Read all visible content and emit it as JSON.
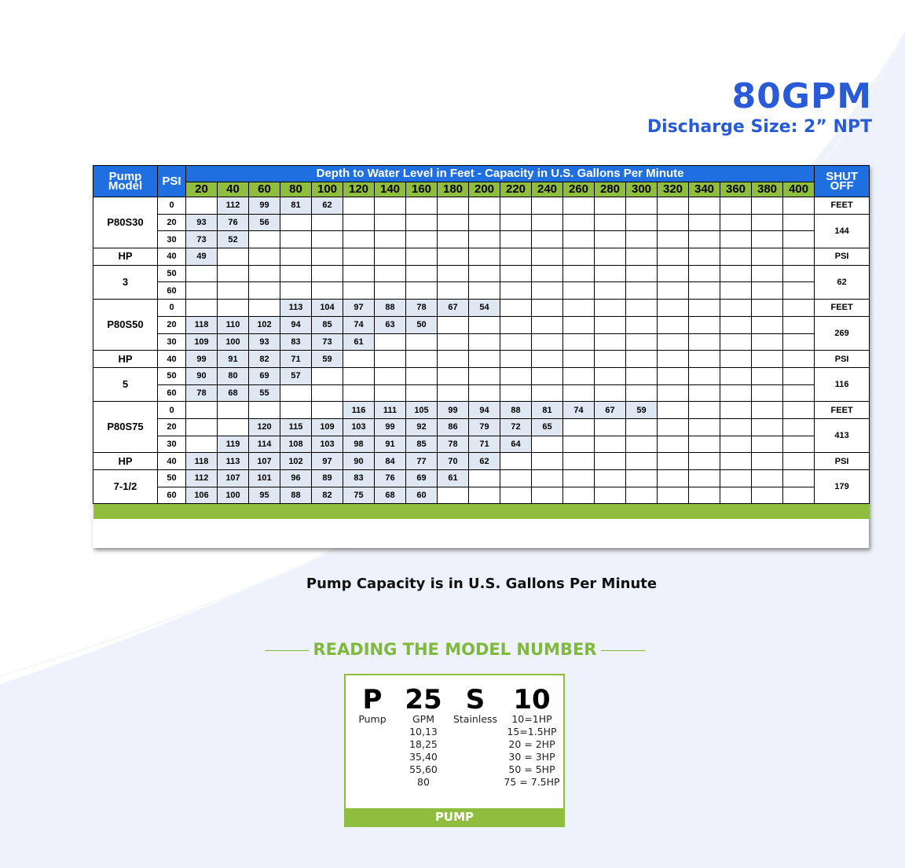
{
  "header": {
    "title": "80GPM",
    "subtitle": "Discharge Size: 2” NPT"
  },
  "table": {
    "col_pump_model": "Pump Model",
    "col_psi": "PSI",
    "depth_title": "Depth to Water Level in Feet - Capacity in U.S. Gallons Per Minute",
    "col_shut_off": "SHUT OFF",
    "depths": [
      "20",
      "40",
      "60",
      "80",
      "100",
      "120",
      "140",
      "160",
      "180",
      "200",
      "220",
      "240",
      "260",
      "280",
      "300",
      "320",
      "340",
      "360",
      "380",
      "400"
    ],
    "groups": [
      {
        "model": "P80S30",
        "hp_label": "HP",
        "hp": "3",
        "rows": [
          {
            "psi": "0",
            "values": [
              "",
              "112",
              "99",
              "81",
              "62"
            ]
          },
          {
            "psi": "20",
            "values": [
              "93",
              "76",
              "56"
            ]
          },
          {
            "psi": "30",
            "values": [
              "73",
              "52"
            ]
          },
          {
            "psi": "40",
            "values": [
              "49"
            ]
          },
          {
            "psi": "50",
            "values": []
          },
          {
            "psi": "60",
            "values": []
          }
        ],
        "shut": [
          "FEET",
          "144",
          "PSI",
          "62"
        ]
      },
      {
        "model": "P80S50",
        "hp_label": "HP",
        "hp": "5",
        "rows": [
          {
            "psi": "0",
            "values": [
              "",
              "",
              "",
              "113",
              "104",
              "97",
              "88",
              "78",
              "67",
              "54"
            ]
          },
          {
            "psi": "20",
            "values": [
              "118",
              "110",
              "102",
              "94",
              "85",
              "74",
              "63",
              "50"
            ]
          },
          {
            "psi": "30",
            "values": [
              "109",
              "100",
              "93",
              "83",
              "73",
              "61"
            ]
          },
          {
            "psi": "40",
            "values": [
              "99",
              "91",
              "82",
              "71",
              "59"
            ]
          },
          {
            "psi": "50",
            "values": [
              "90",
              "80",
              "69",
              "57"
            ]
          },
          {
            "psi": "60",
            "values": [
              "78",
              "68",
              "55"
            ]
          }
        ],
        "shut": [
          "FEET",
          "269",
          "PSI",
          "116"
        ]
      },
      {
        "model": "P80S75",
        "hp_label": "HP",
        "hp": "7-1/2",
        "rows": [
          {
            "psi": "0",
            "values": [
              "",
              "",
              "",
              "",
              "",
              "116",
              "111",
              "105",
              "99",
              "94",
              "88",
              "81",
              "74",
              "67",
              "59"
            ]
          },
          {
            "psi": "20",
            "values": [
              "",
              "",
              "120",
              "115",
              "109",
              "103",
              "99",
              "92",
              "86",
              "79",
              "72",
              "65"
            ]
          },
          {
            "psi": "30",
            "values": [
              "",
              "119",
              "114",
              "108",
              "103",
              "98",
              "91",
              "85",
              "78",
              "71",
              "64"
            ]
          },
          {
            "psi": "40",
            "values": [
              "118",
              "113",
              "107",
              "102",
              "97",
              "90",
              "84",
              "77",
              "70",
              "62"
            ]
          },
          {
            "psi": "50",
            "values": [
              "112",
              "107",
              "101",
              "96",
              "89",
              "83",
              "76",
              "69",
              "61"
            ]
          },
          {
            "psi": "60",
            "values": [
              "106",
              "100",
              "95",
              "88",
              "82",
              "75",
              "68",
              "60"
            ]
          }
        ],
        "shut": [
          "FEET",
          "413",
          "PSI",
          "179"
        ]
      }
    ]
  },
  "caption": "Pump Capacity is in U.S. Gallons Per Minute",
  "reading": {
    "title": "READING THE MODEL NUMBER",
    "columns": [
      {
        "big": "P",
        "lines": [
          "Pump"
        ]
      },
      {
        "big": "25",
        "lines": [
          "GPM",
          "10,13",
          "18,25",
          "35,40",
          "55,60",
          "80"
        ]
      },
      {
        "big": "S",
        "lines": [
          "Stainless"
        ]
      },
      {
        "big": "10",
        "lines": [
          "10=1HP",
          "15=1.5HP",
          "20 = 2HP",
          "30 = 3HP",
          "50 = 5HP",
          "75 = 7.5HP"
        ]
      }
    ],
    "footer": "PUMP"
  },
  "colors": {
    "blue_header": "#1f6fe0",
    "green_header": "#8fbe3f",
    "value_cell": "#dfe7f3",
    "title_blue": "#2a5bd7",
    "green_text": "#7fb83a",
    "background_swoosh": "#eef2fc"
  }
}
